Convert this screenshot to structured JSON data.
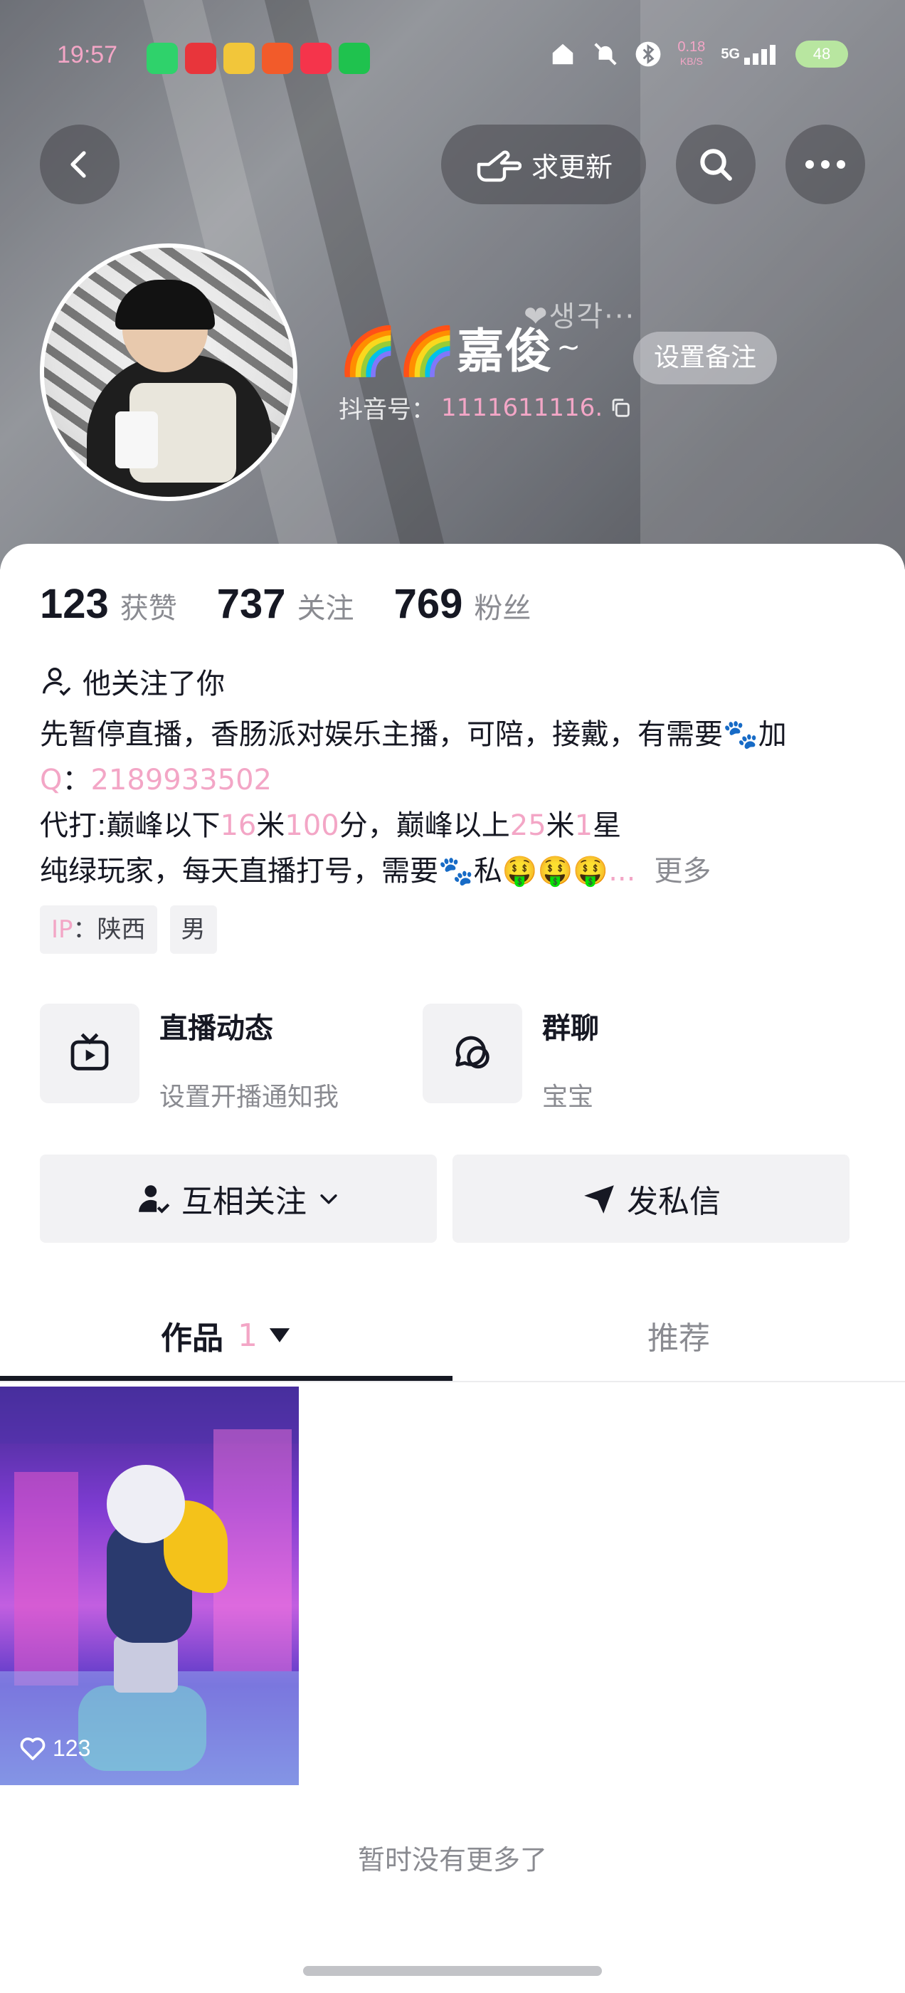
{
  "status_bar": {
    "time": "19:57",
    "net_speed_value": "0.18",
    "net_speed_unit": "KB/S",
    "network": "5G",
    "battery": "48"
  },
  "top_nav": {
    "request_update_label": "求更新"
  },
  "profile": {
    "nickname": "🌈🌈嘉俊",
    "nickname_suffix": "~",
    "overlay_text": "❤생각···",
    "remark_button": "设置备注",
    "douyin_id_label": "抖音号：",
    "douyin_id_value": "1111611116."
  },
  "stats": {
    "likes_count": "123",
    "likes_label": "获赞",
    "following_count": "737",
    "following_label": "关注",
    "followers_count": "769",
    "followers_label": "粉丝"
  },
  "follows_you_text": "他关注了你",
  "bio": {
    "line1": "先暂停直播，香肠派对娱乐主播，可陪，接戴，有需要🐾加",
    "line2_prefix": "Q",
    "line2_colon": "：",
    "line2_value": "2189933502",
    "line3_a": "代打:巅峰以下",
    "line3_b": "16",
    "line3_c": "米",
    "line3_d": "100",
    "line3_e": "分，巅峰以上",
    "line3_f": "25",
    "line3_g": "米",
    "line3_h": "1",
    "line3_i": "星",
    "line4": "纯绿玩家，每天直播打号，需要🐾私🤑🤑🤑",
    "line4_ellipsis": "...",
    "more_label": "更多"
  },
  "tags": {
    "ip_label": "IP",
    "ip_value": "：陕西",
    "gender": "男"
  },
  "features": {
    "live_title": "直播动态",
    "live_subtitle": "设置开播通知我",
    "group_title": "群聊",
    "group_subtitle": "宝宝"
  },
  "actions": {
    "mutual_follow": "互相关注",
    "message": "发私信"
  },
  "tabs": {
    "works_label": "作品",
    "works_count": "1",
    "recommend_label": "推荐"
  },
  "video": {
    "likes": "123"
  },
  "footer": {
    "no_more": "暂时没有更多了"
  },
  "colors": {
    "accent_pink": "#f3a6c6",
    "text_primary": "#161823",
    "text_secondary": "#8a8b91",
    "chip_bg": "#f2f2f4"
  }
}
